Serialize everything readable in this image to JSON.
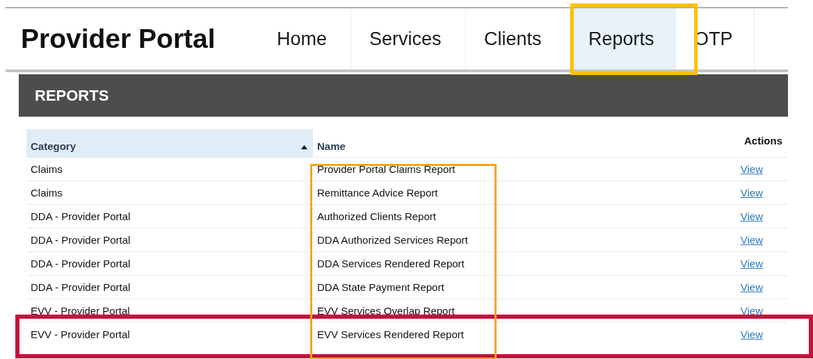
{
  "header": {
    "title": "Provider Portal"
  },
  "tabs": [
    {
      "label": "Home",
      "selected": false,
      "highlighted": false
    },
    {
      "label": "Services",
      "selected": false,
      "highlighted": false
    },
    {
      "label": "Clients",
      "selected": false,
      "highlighted": false
    },
    {
      "label": "Reports",
      "selected": true,
      "highlighted": true
    },
    {
      "label": "OTP",
      "selected": false,
      "highlighted": false
    }
  ],
  "section": {
    "title": "REPORTS"
  },
  "table": {
    "columns": [
      {
        "label": "Category",
        "sorted": true
      },
      {
        "label": "Name",
        "sorted": false
      },
      {
        "label": "Actions",
        "sorted": false
      }
    ],
    "name_column_highlighted": true,
    "rows": [
      {
        "category": "Claims",
        "name": "Provider Portal Claims Report",
        "action": "View",
        "highlighted": false
      },
      {
        "category": "Claims",
        "name": "Remittance Advice Report",
        "action": "View",
        "highlighted": false
      },
      {
        "category": "DDA - Provider Portal",
        "name": "Authorized Clients Report",
        "action": "View",
        "highlighted": false
      },
      {
        "category": "DDA - Provider Portal",
        "name": "DDA Authorized Services Report",
        "action": "View",
        "highlighted": false
      },
      {
        "category": "DDA - Provider Portal",
        "name": "DDA Services Rendered Report",
        "action": "View",
        "highlighted": false
      },
      {
        "category": "DDA - Provider Portal",
        "name": "DDA State Payment Report",
        "action": "View",
        "highlighted": false
      },
      {
        "category": "EVV - Provider Portal",
        "name": "EVV Services Overlap Report",
        "action": "View",
        "highlighted": false
      },
      {
        "category": "EVV - Provider Portal",
        "name": "EVV Services Rendered Report",
        "action": "View",
        "highlighted": true
      }
    ]
  }
}
